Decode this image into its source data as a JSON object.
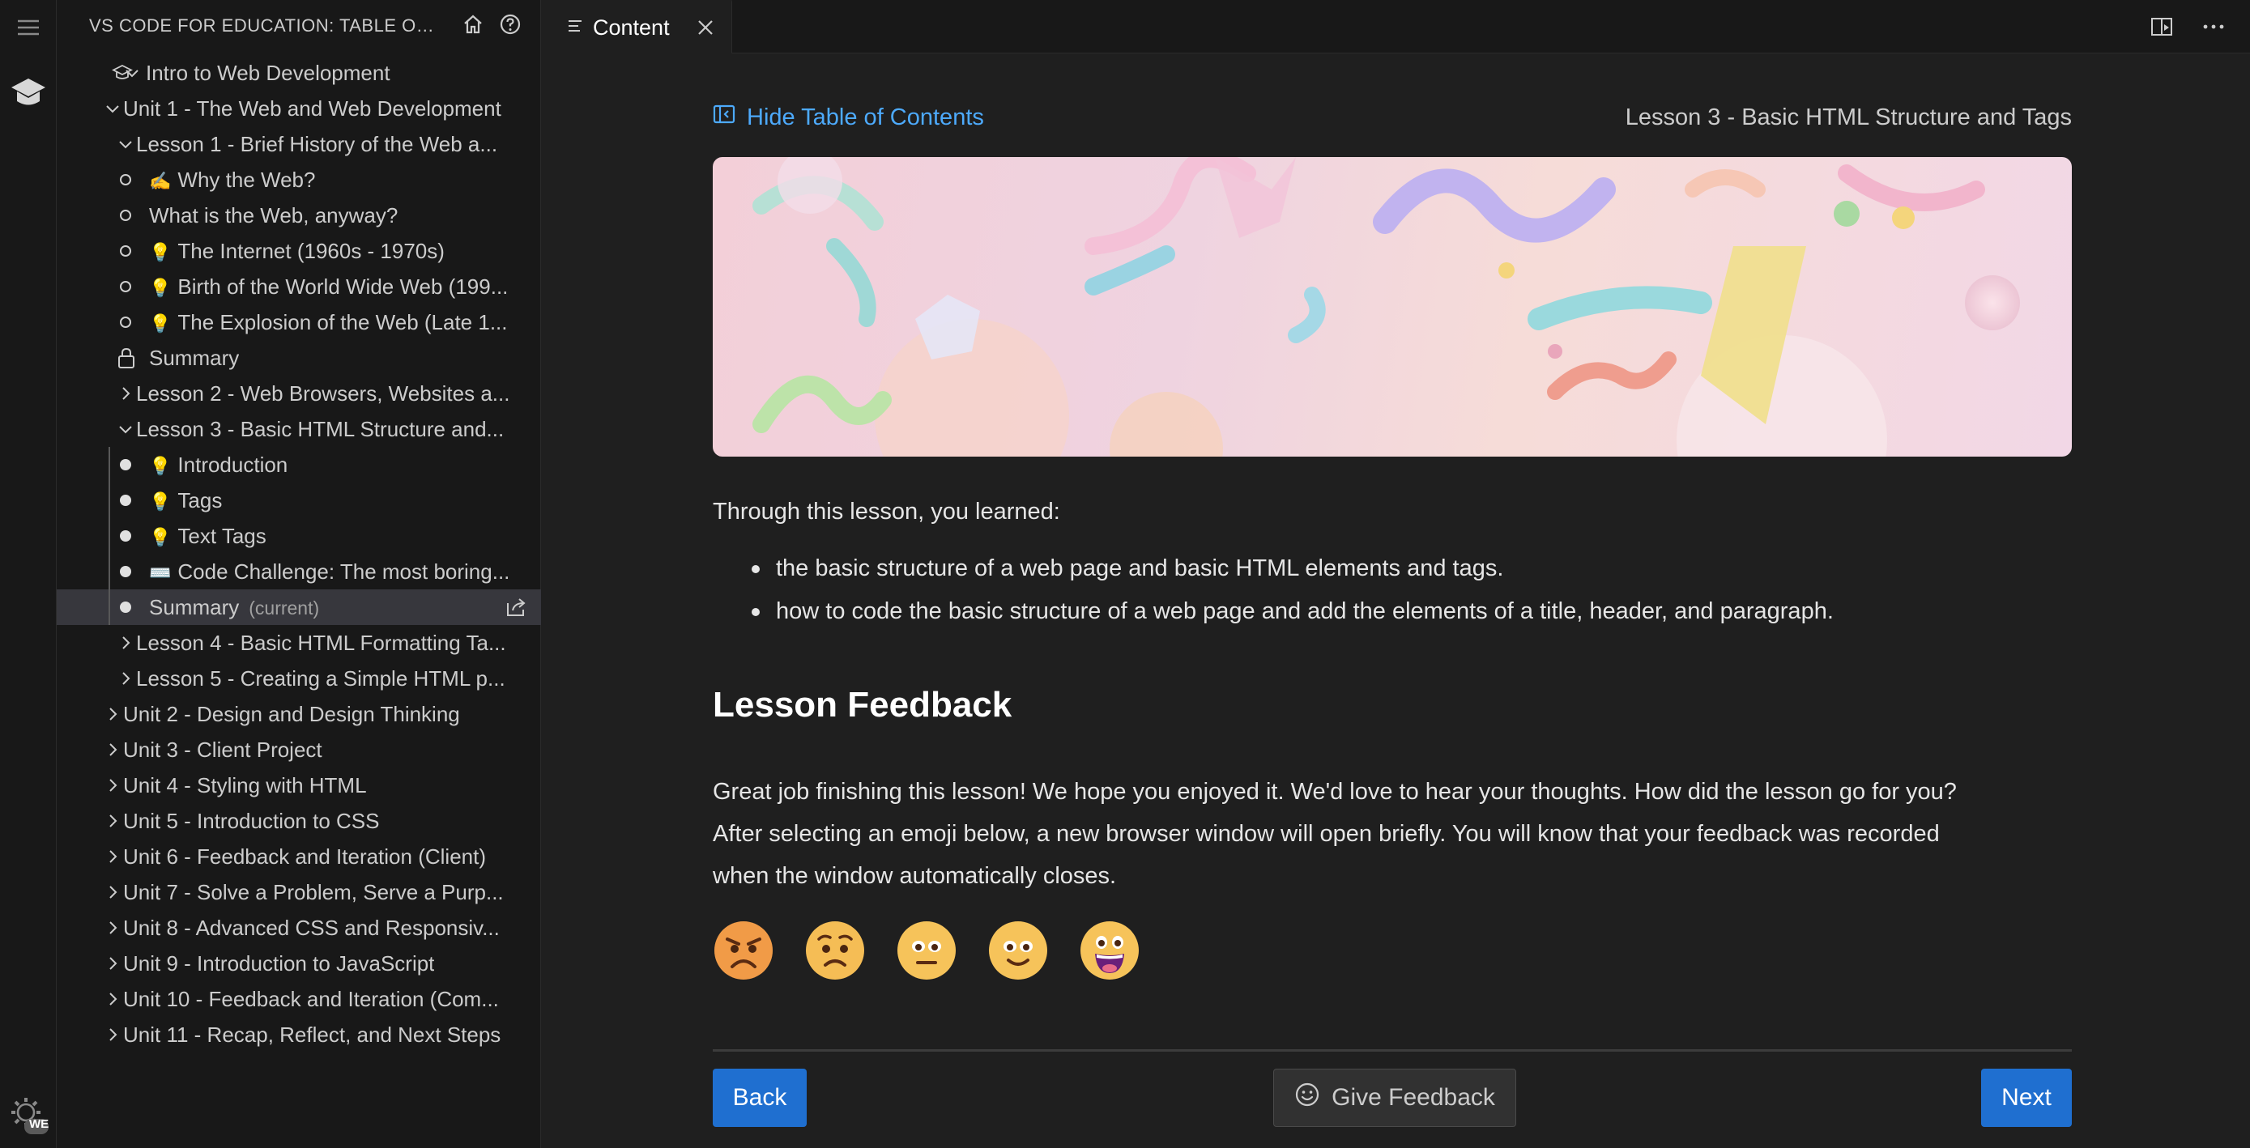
{
  "sidebar": {
    "title": "VS CODE FOR EDUCATION: TABLE OF ...",
    "tree": [
      {
        "label": "Intro to Web Development",
        "indent": 0,
        "chevron": "down",
        "icon": "cap"
      },
      {
        "label": "Unit 1 - The Web and Web Development",
        "indent": 1,
        "chevron": "down"
      },
      {
        "label": "Lesson 1 - Brief History of the Web a...",
        "indent": 2,
        "chevron": "down"
      },
      {
        "label": "Why the Web?",
        "indent": 3,
        "dot": "hollow",
        "emoji": "✍️"
      },
      {
        "label": "What is the Web, anyway?",
        "indent": 3,
        "dot": "hollow"
      },
      {
        "label": "The Internet (1960s - 1970s)",
        "indent": 3,
        "dot": "hollow",
        "emoji": "💡"
      },
      {
        "label": "Birth of the World Wide Web (199...",
        "indent": 3,
        "dot": "hollow",
        "emoji": "💡"
      },
      {
        "label": "The Explosion of the Web (Late 1...",
        "indent": 3,
        "dot": "hollow",
        "emoji": "💡"
      },
      {
        "label": "Summary",
        "indent": 3,
        "dot": "lock"
      },
      {
        "label": "Lesson 2 - Web Browsers, Websites a...",
        "indent": 2,
        "chevron": "right"
      },
      {
        "label": "Lesson 3 - Basic HTML Structure and...",
        "indent": 2,
        "chevron": "down"
      },
      {
        "label": "Introduction",
        "indent": 3,
        "dot": "filled",
        "emoji": "💡",
        "guide": true
      },
      {
        "label": "Tags",
        "indent": 3,
        "dot": "filled",
        "emoji": "💡",
        "guide": true
      },
      {
        "label": "Text Tags",
        "indent": 3,
        "dot": "filled",
        "emoji": "💡",
        "guide": true
      },
      {
        "label": "Code Challenge: The most boring...",
        "indent": 3,
        "dot": "filled",
        "emoji": "⌨️",
        "guide": true
      },
      {
        "label": "Summary",
        "indent": 3,
        "dot": "filled",
        "guide": true,
        "current": true,
        "current_note": "(current)"
      },
      {
        "label": "Lesson 4 - Basic HTML Formatting Ta...",
        "indent": 2,
        "chevron": "right"
      },
      {
        "label": "Lesson 5 - Creating a Simple HTML p...",
        "indent": 2,
        "chevron": "right"
      },
      {
        "label": "Unit 2 - Design and Design Thinking",
        "indent": 1,
        "chevron": "right"
      },
      {
        "label": "Unit 3 - Client Project",
        "indent": 1,
        "chevron": "right"
      },
      {
        "label": "Unit 4 - Styling with HTML",
        "indent": 1,
        "chevron": "right"
      },
      {
        "label": "Unit 5 - Introduction to CSS",
        "indent": 1,
        "chevron": "right"
      },
      {
        "label": "Unit 6 - Feedback and Iteration (Client)",
        "indent": 1,
        "chevron": "right"
      },
      {
        "label": "Unit 7 - Solve a Problem, Serve a Purp...",
        "indent": 1,
        "chevron": "right"
      },
      {
        "label": "Unit 8 - Advanced CSS and Responsiv...",
        "indent": 1,
        "chevron": "right"
      },
      {
        "label": "Unit 9 - Introduction to JavaScript",
        "indent": 1,
        "chevron": "right"
      },
      {
        "label": "Unit 10 - Feedback and Iteration (Com...",
        "indent": 1,
        "chevron": "right"
      },
      {
        "label": "Unit 11 - Recap, Reflect, and Next Steps",
        "indent": 1,
        "chevron": "right"
      }
    ]
  },
  "activity": {
    "badge": "WE"
  },
  "tab": {
    "label": "Content"
  },
  "content": {
    "hide_toc": "Hide Table of Contents",
    "lesson_title": "Lesson 3 - Basic HTML Structure and Tags",
    "intro": "Through this lesson, you learned:",
    "bullets": [
      "the basic structure of a web page and basic HTML elements and tags.",
      "how to code the basic structure of a web page and add the elements of a title, header, and paragraph."
    ],
    "feedback_heading": "Lesson Feedback",
    "feedback_text": [
      "Great job finishing this lesson! We hope you enjoyed it. We'd love to hear your thoughts. How did the lesson go for you?",
      "After selecting an emoji below, a new browser window will open briefly. You will know that your feedback was recorded",
      "when the window automatically closes."
    ],
    "emojis": [
      "angry",
      "frowning",
      "neutral",
      "slightly-smiling",
      "grinning"
    ],
    "back_label": "Back",
    "give_feedback_label": "Give Feedback",
    "next_label": "Next"
  },
  "colors": {
    "accent": "#4daafc",
    "button": "#1f6fd0",
    "selected_row": "#37373d"
  }
}
